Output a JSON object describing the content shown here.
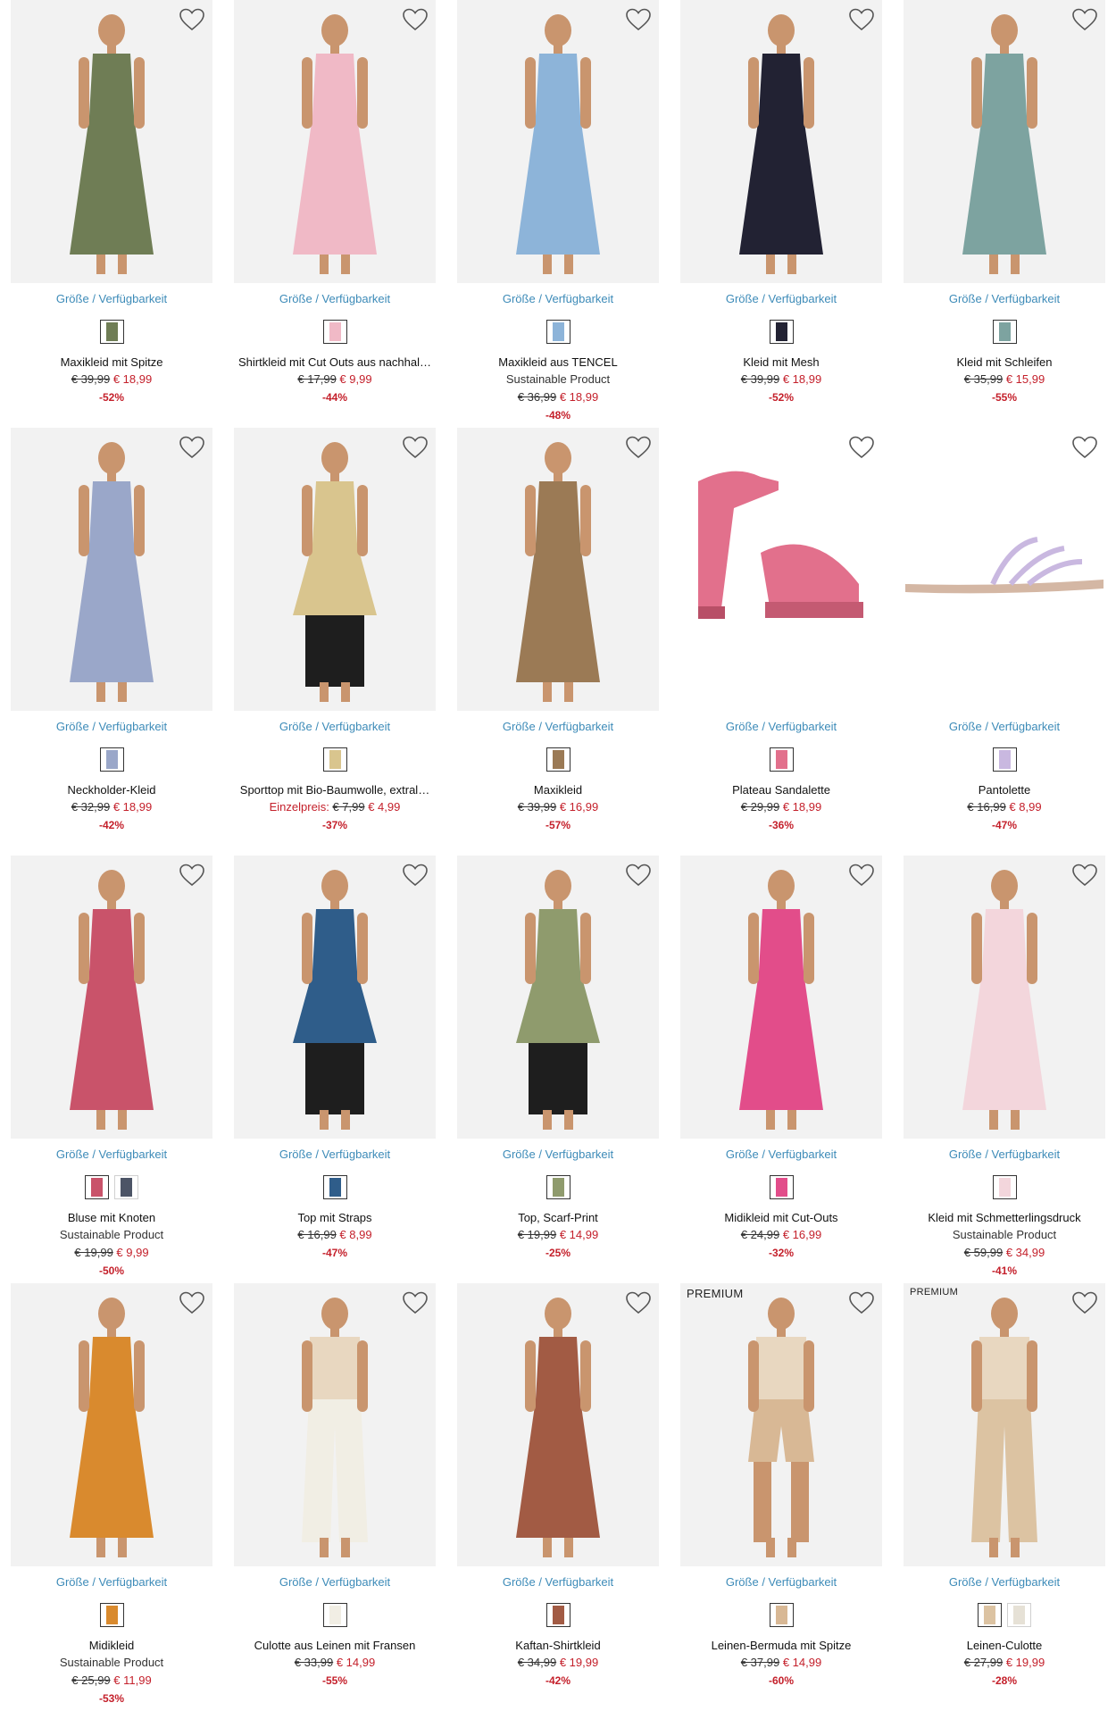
{
  "size_link_label": "Größe / Verfügbarkeit",
  "colors": {
    "sale": "#c4202b",
    "link": "#3d8bb8"
  },
  "products": [
    {
      "name": "Maxikleid mit Spitze",
      "sub": "",
      "price_prefix": "",
      "old_price": "€ 39,99",
      "new_price": "€ 18,99",
      "discount": "-52%",
      "premium": "",
      "swatches": [
        "#6f7d55"
      ],
      "bg": "#f2f2f2"
    },
    {
      "name": "Shirtkleid mit Cut Outs aus nachhal…",
      "sub": "",
      "price_prefix": "",
      "old_price": "€ 17,99",
      "new_price": "€ 9,99",
      "discount": "-44%",
      "premium": "",
      "swatches": [
        "#f0b9c6"
      ],
      "bg": "#f2f2f2"
    },
    {
      "name": "Maxikleid aus TENCEL",
      "sub": "Sustainable Product",
      "price_prefix": "",
      "old_price": "€ 36,99",
      "new_price": "€ 18,99",
      "discount": "-48%",
      "premium": "",
      "swatches": [
        "#8db4d9"
      ],
      "bg": "#f2f2f2"
    },
    {
      "name": "Kleid mit Mesh",
      "sub": "",
      "price_prefix": "",
      "old_price": "€ 39,99",
      "new_price": "€ 18,99",
      "discount": "-52%",
      "premium": "",
      "swatches": [
        "#222233"
      ],
      "bg": "#f2f2f2"
    },
    {
      "name": "Kleid mit Schleifen",
      "sub": "",
      "price_prefix": "",
      "old_price": "€ 35,99",
      "new_price": "€ 15,99",
      "discount": "-55%",
      "premium": "",
      "swatches": [
        "#7da3a0"
      ],
      "bg": "#f2f2f2"
    },
    {
      "name": "Neckholder-Kleid",
      "sub": "",
      "price_prefix": "",
      "old_price": "€ 32,99",
      "new_price": "€ 18,99",
      "discount": "-42%",
      "premium": "",
      "swatches": [
        "#9aa7c9"
      ],
      "bg": "#f2f2f2"
    },
    {
      "name": "Sporttop mit Bio-Baumwolle, extral…",
      "sub": "",
      "price_prefix": "Einzelpreis:",
      "old_price": "€ 7,99",
      "new_price": "€ 4,99",
      "discount": "-37%",
      "premium": "",
      "swatches": [
        "#d9c58e"
      ],
      "bg": "#f2f2f2"
    },
    {
      "name": "Maxikleid",
      "sub": "",
      "price_prefix": "",
      "old_price": "€ 39,99",
      "new_price": "€ 16,99",
      "discount": "-57%",
      "premium": "",
      "swatches": [
        "#9b7a55"
      ],
      "bg": "#f2f2f2"
    },
    {
      "name": "Plateau Sandalette",
      "sub": "",
      "price_prefix": "",
      "old_price": "€ 29,99",
      "new_price": "€ 18,99",
      "discount": "-36%",
      "premium": "",
      "swatches": [
        "#e2708c"
      ],
      "bg": "#ffffff"
    },
    {
      "name": "Pantolette",
      "sub": "",
      "price_prefix": "",
      "old_price": "€ 16,99",
      "new_price": "€ 8,99",
      "discount": "-47%",
      "premium": "",
      "swatches": [
        "#c9b8e0"
      ],
      "bg": "#ffffff"
    },
    {
      "name": "Bluse mit Knoten",
      "sub": "Sustainable Product",
      "price_prefix": "",
      "old_price": "€ 19,99",
      "new_price": "€ 9,99",
      "discount": "-50%",
      "premium": "",
      "swatches": [
        "#c9536a",
        "#4c5466"
      ],
      "bg": "#f2f2f2"
    },
    {
      "name": "Top mit Straps",
      "sub": "",
      "price_prefix": "",
      "old_price": "€ 16,99",
      "new_price": "€ 8,99",
      "discount": "-47%",
      "premium": "",
      "swatches": [
        "#2f5d8a"
      ],
      "bg": "#f2f2f2"
    },
    {
      "name": "Top, Scarf-Print",
      "sub": "",
      "price_prefix": "",
      "old_price": "€ 19,99",
      "new_price": "€ 14,99",
      "discount": "-25%",
      "premium": "",
      "swatches": [
        "#8f9b6d"
      ],
      "bg": "#f2f2f2"
    },
    {
      "name": "Midikleid mit Cut-Outs",
      "sub": "",
      "price_prefix": "",
      "old_price": "€ 24,99",
      "new_price": "€ 16,99",
      "discount": "-32%",
      "premium": "",
      "swatches": [
        "#e24d8a"
      ],
      "bg": "#f2f2f2"
    },
    {
      "name": "Kleid mit Schmetterlingsdruck",
      "sub": "Sustainable Product",
      "price_prefix": "",
      "old_price": "€ 59,99",
      "new_price": "€ 34,99",
      "discount": "-41%",
      "premium": "",
      "swatches": [
        "#f3d6dc"
      ],
      "bg": "#f2f2f2"
    },
    {
      "name": "Midikleid",
      "sub": "Sustainable Product",
      "price_prefix": "",
      "old_price": "€ 25,99",
      "new_price": "€ 11,99",
      "discount": "-53%",
      "premium": "",
      "swatches": [
        "#d98a2e"
      ],
      "bg": "#f2f2f2"
    },
    {
      "name": "Culotte aus Leinen mit Fransen",
      "sub": "",
      "price_prefix": "",
      "old_price": "€ 33,99",
      "new_price": "€ 14,99",
      "discount": "-55%",
      "premium": "",
      "swatches": [
        "#f1eee4"
      ],
      "bg": "#f2f2f2"
    },
    {
      "name": "Kaftan-Shirtkleid",
      "sub": "",
      "price_prefix": "",
      "old_price": "€ 34,99",
      "new_price": "€ 19,99",
      "discount": "-42%",
      "premium": "",
      "swatches": [
        "#a25b44"
      ],
      "bg": "#f2f2f2"
    },
    {
      "name": "Leinen-Bermuda mit Spitze",
      "sub": "",
      "price_prefix": "",
      "old_price": "€ 37,99",
      "new_price": "€ 14,99",
      "discount": "-60%",
      "premium": "PREMIUM",
      "swatches": [
        "#d8b895"
      ],
      "bg": "#f2f2f2"
    },
    {
      "name": "Leinen-Culotte",
      "sub": "",
      "price_prefix": "",
      "old_price": "€ 27,99",
      "new_price": "€ 19,99",
      "discount": "-28%",
      "premium": "PREMIUM",
      "swatches": [
        "#dcc3a2",
        "#e6e1d6"
      ],
      "bg": "#f2f2f2"
    }
  ]
}
